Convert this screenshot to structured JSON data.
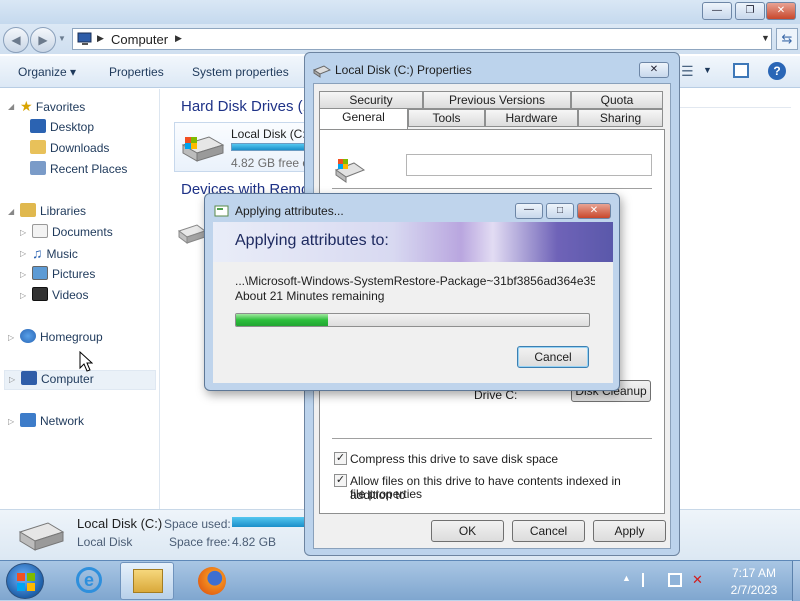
{
  "explorer": {
    "address": "Computer",
    "toolbar": {
      "organize": "Organize ▾",
      "properties": "Properties",
      "system_properties": "System properties"
    },
    "nav": {
      "favorites": "Favorites",
      "desktop": "Desktop",
      "downloads": "Downloads",
      "recent_places": "Recent Places",
      "libraries": "Libraries",
      "documents": "Documents",
      "music": "Music",
      "pictures": "Pictures",
      "videos": "Videos",
      "homegroup": "Homegroup",
      "computer": "Computer",
      "network": "Network"
    },
    "content": {
      "hard_disk_group": "Hard Disk Drives (1",
      "drive_name": "Local Disk (C:",
      "drive_free": "4.82 GB free o",
      "devices_group": "Devices with Remo"
    },
    "details": {
      "name": "Local Disk (C:)",
      "type": "Local Disk",
      "space_used_label": "Space used:",
      "space_free_label": "Space free:",
      "space_free_value": "4.82 GB"
    }
  },
  "properties_dialog": {
    "title": "Local Disk (C:) Properties",
    "tabs_back": [
      "Security",
      "Previous Versions",
      "Quota"
    ],
    "tabs_front": [
      "General",
      "Tools",
      "Hardware",
      "Sharing"
    ],
    "active_tab": "General",
    "disk_cleanup_label": "Disk Cleanup",
    "drive_label": "Drive C:",
    "compress_label": "Compress this drive to save disk space",
    "compress_checked": "✓",
    "index_label_line1": "Allow files on this drive to have contents indexed in addition to",
    "index_label_line2": "file properties",
    "index_checked": "✓",
    "ok": "OK",
    "cancel": "Cancel",
    "apply": "Apply"
  },
  "apply_dialog": {
    "title": "Applying attributes...",
    "heading": "Applying attributes to:",
    "path": "...\\Microsoft-Windows-SystemRestore-Package~31bf3856ad364e35~",
    "remaining": "About 21 Minutes remaining",
    "progress_fraction": 0.26,
    "cancel": "Cancel"
  },
  "taskbar": {
    "time": "7:17 AM",
    "date": "2/7/2023"
  },
  "icons": {
    "back": "arrow-left-icon",
    "forward": "arrow-right-icon",
    "help": "help-icon"
  }
}
